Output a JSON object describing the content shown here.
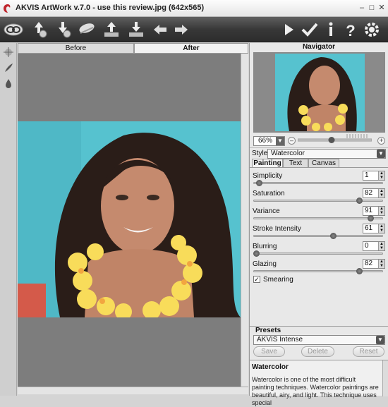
{
  "window": {
    "title": "AKVIS ArtWork v.7.0 - use this review.jpg (642x565)"
  },
  "toolbar": {
    "left": [
      "logo-icon",
      "open-icon",
      "save-icon",
      "eraser-icon",
      "share-icon",
      "print-icon",
      "undo-icon",
      "redo-icon"
    ],
    "right": [
      "run-icon",
      "apply-icon",
      "info-icon",
      "help-icon",
      "settings-icon"
    ]
  },
  "view_tabs": {
    "before": "Before",
    "after": "After"
  },
  "navigator": {
    "title": "Navigator",
    "zoom": "66%"
  },
  "style": {
    "label": "Style:",
    "value": "Watercolor"
  },
  "param_tabs": {
    "painting": "Painting",
    "text": "Text",
    "canvas": "Canvas"
  },
  "params": [
    {
      "label": "Simplicity",
      "value": "1",
      "level": 0.02
    },
    {
      "label": "Saturation",
      "value": "82",
      "level": 0.82
    },
    {
      "label": "Variance",
      "value": "91",
      "level": 0.91
    },
    {
      "label": "Stroke Intensity",
      "value": "61",
      "level": 0.61
    },
    {
      "label": "Blurring",
      "value": "0",
      "level": 0.0
    },
    {
      "label": "Glazing",
      "value": "82",
      "level": 0.82
    }
  ],
  "smearing": {
    "label": "Smearing",
    "checked": true
  },
  "presets": {
    "title": "Presets",
    "value": "AKVIS Intense",
    "save": "Save",
    "delete": "Delete",
    "reset": "Reset"
  },
  "help": {
    "title": "Watercolor",
    "body": "Watercolor is one of the most difficult painting techniques. Watercolor paintings are beautiful, airy, and light. This technique uses special"
  }
}
